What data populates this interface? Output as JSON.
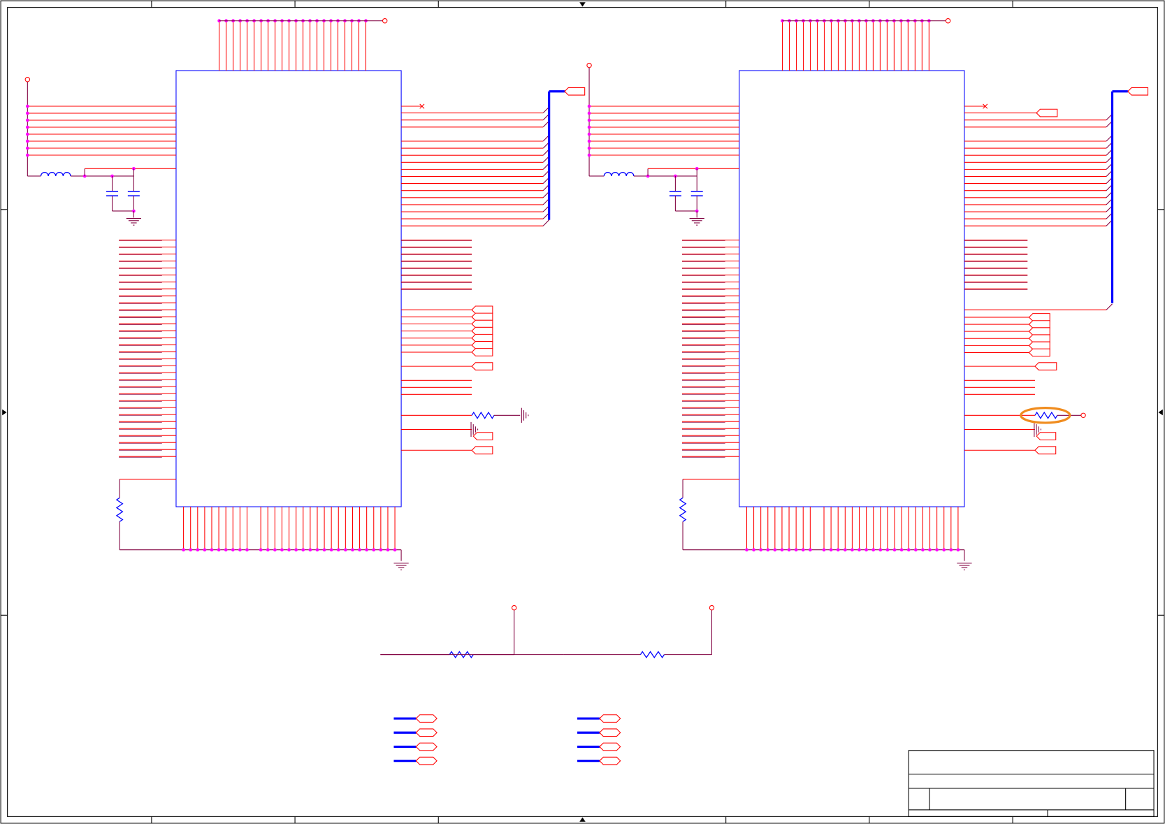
{
  "title_block": {},
  "colors": {
    "frame": "#000000",
    "part_outline": "#0000ff",
    "pin": "#ff0000",
    "net_wire": "#800040",
    "bus": "#0000ff",
    "junction": "#ff00ff",
    "port": "#ff0000",
    "passive": "#0000ff",
    "highlight": "#f08c1e",
    "background": "#ffffff"
  },
  "icons": [
    "resistor-icon",
    "inductor-icon",
    "capacitor-icon",
    "ground-icon",
    "power-port-icon",
    "net-port-icon",
    "no-connect-icon",
    "junction-dot-icon",
    "zone-arrow-icon"
  ]
}
